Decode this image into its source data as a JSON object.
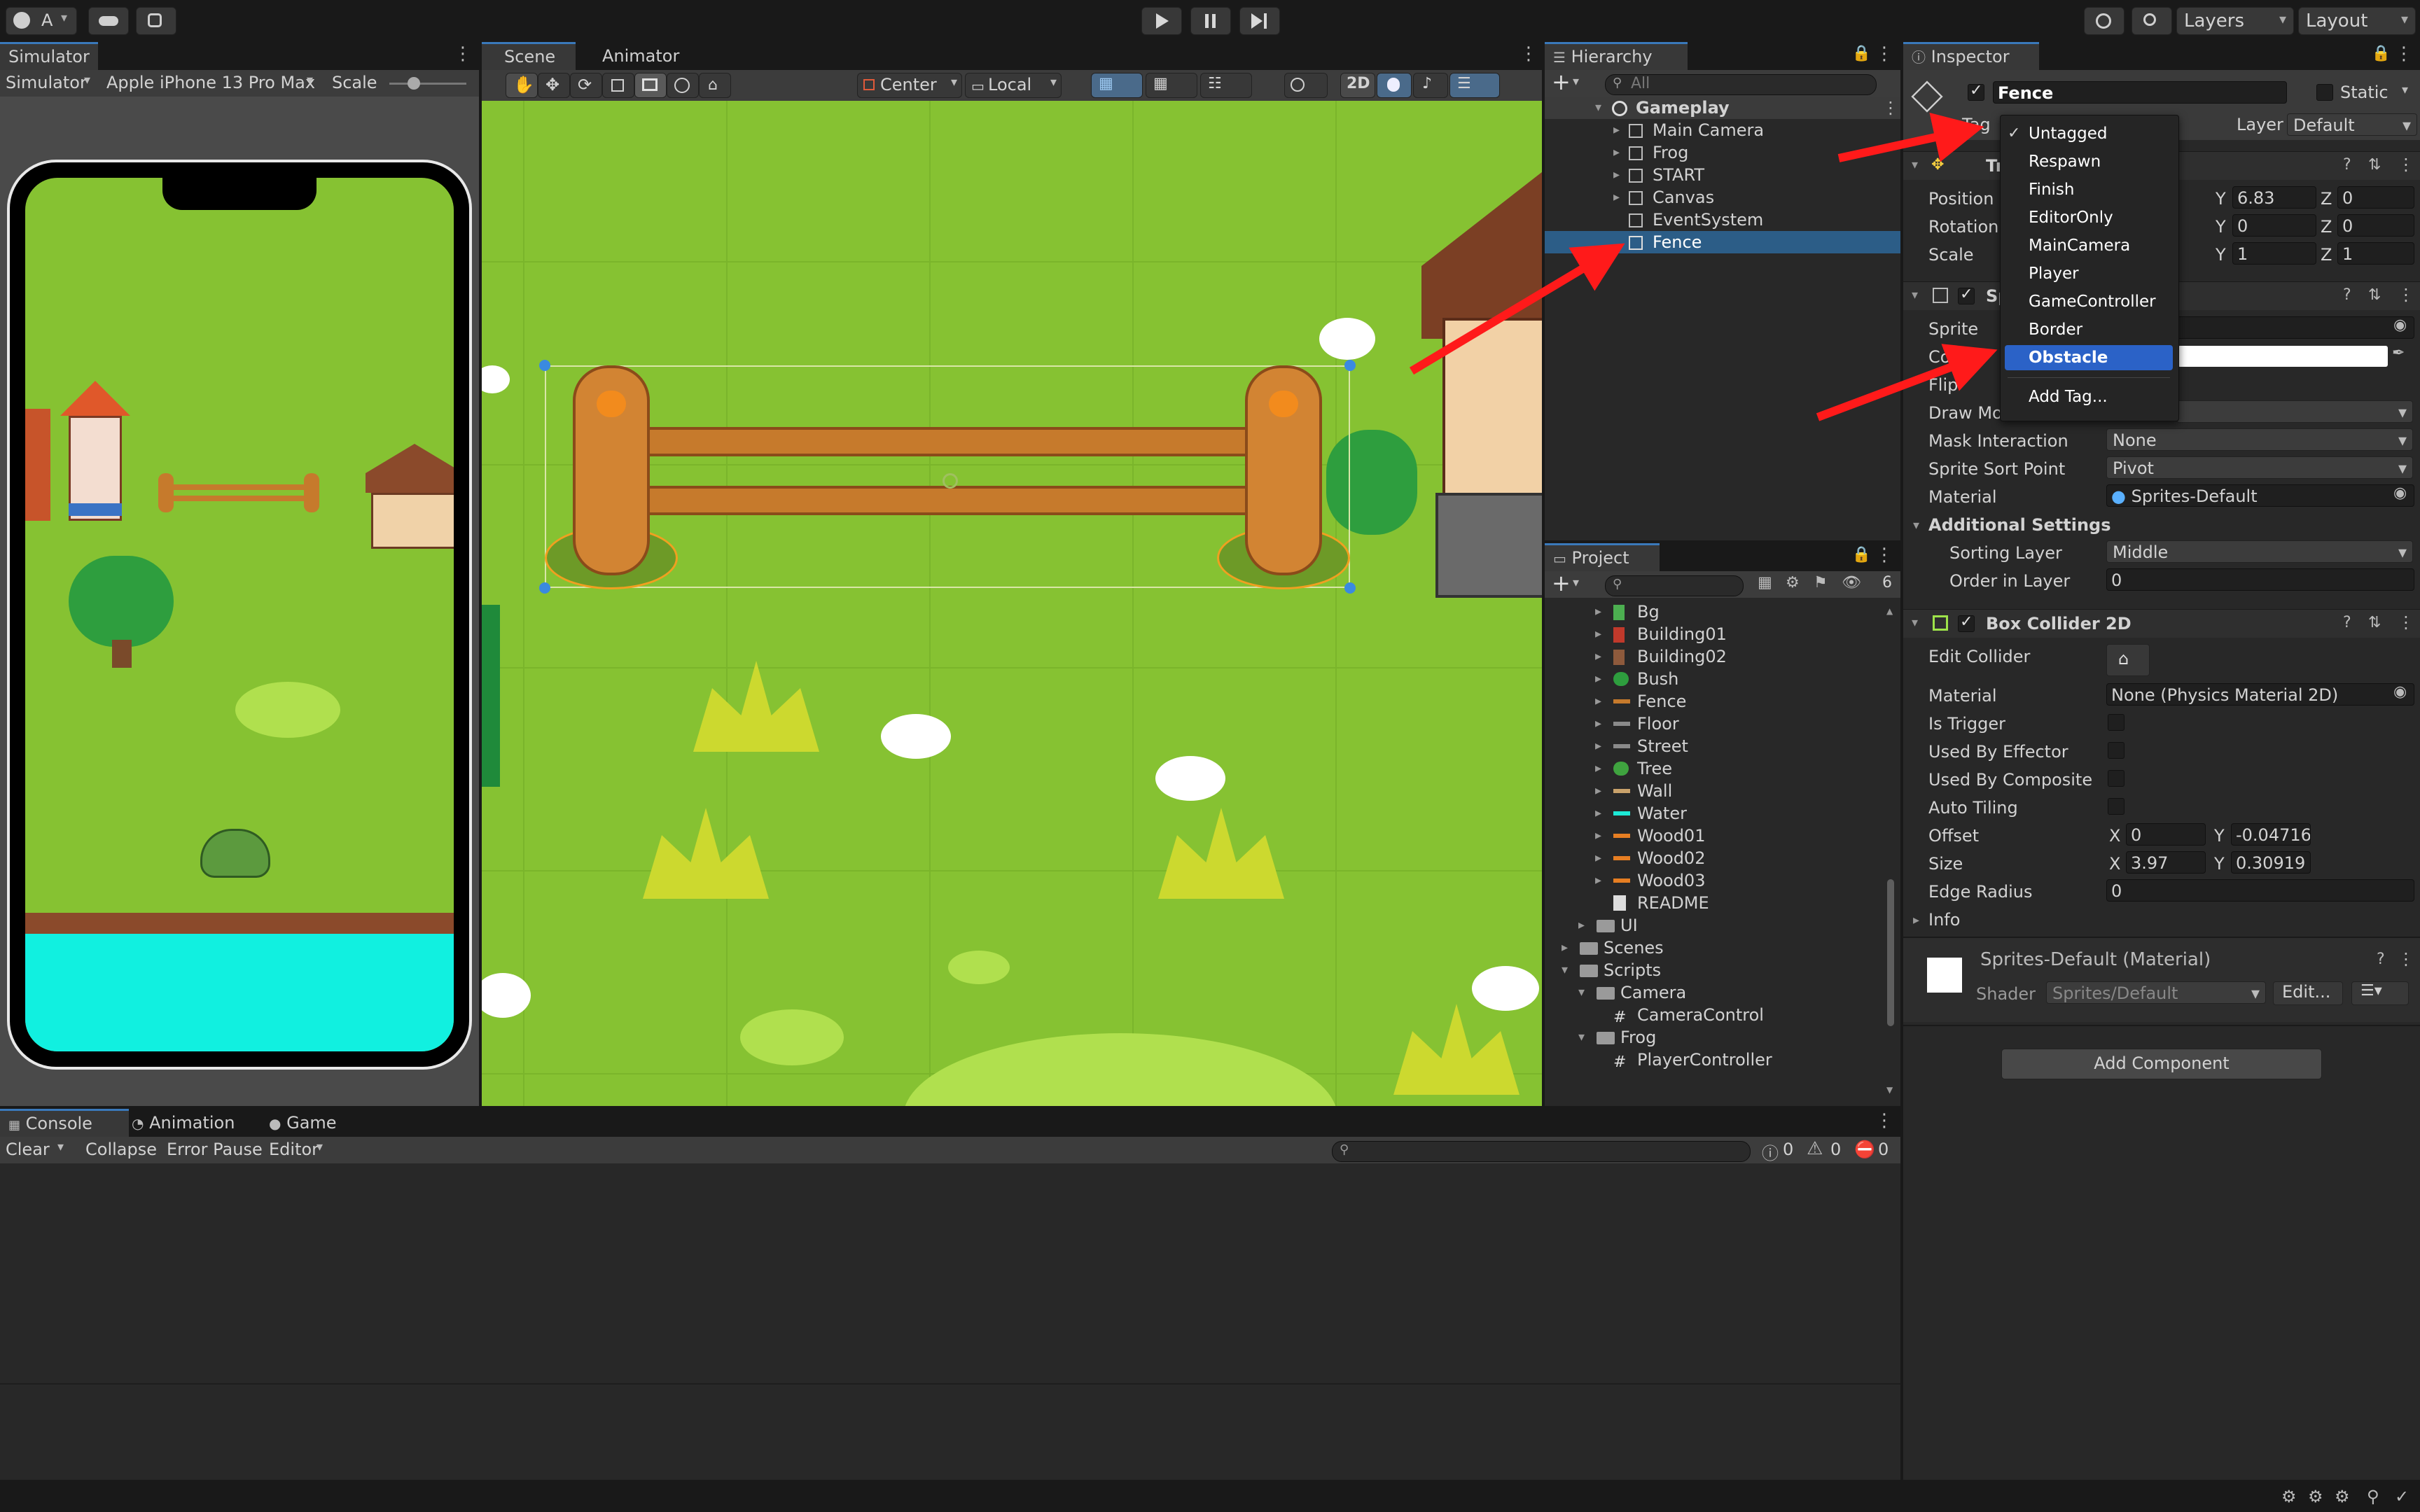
{
  "top_bar": {
    "account_label": "A",
    "layers_label": "Layers",
    "layout_label": "Layout"
  },
  "simulator": {
    "tab_label": "Simulator",
    "mode_label": "Simulator",
    "device_label": "Apple iPhone 13 Pro Max",
    "scale_label": "Scale"
  },
  "scene": {
    "tabs": [
      "Scene",
      "Animator"
    ],
    "pivot_label": "Center",
    "space_label": "Local",
    "mode_2d_label": "2D"
  },
  "hierarchy": {
    "tab_label": "Hierarchy",
    "search_placeholder": "All",
    "scene_name": "Gameplay",
    "items": [
      "Main Camera",
      "Frog",
      "START",
      "Canvas",
      "EventSystem",
      "Fence"
    ],
    "selected": "Fence"
  },
  "project": {
    "tab_label": "Project",
    "hidden_count": "6",
    "assets": [
      "Bg",
      "Building01",
      "Building02",
      "Bush",
      "Fence",
      "Floor",
      "Street",
      "Tree",
      "Wall",
      "Water",
      "Wood01",
      "Wood02",
      "Wood03",
      "README",
      "UI",
      "Scenes",
      "Scripts",
      "Camera",
      "CameraControl",
      "Frog",
      "PlayerController"
    ],
    "asset_colors": [
      "#4caf50",
      "#c0392b",
      "#8e5a3c",
      "#2e9e3e",
      "#c67a2c",
      "#8a8a8a",
      "#8a8a8a",
      "#3fa33f",
      "#c9a26b",
      "#1de9d6",
      "#e67e22",
      "#e67e22",
      "#e67e22"
    ]
  },
  "console": {
    "tabs": [
      "Console",
      "Animation",
      "Game"
    ],
    "clear_label": "Clear",
    "collapse_label": "Collapse",
    "error_pause_label": "Error Pause",
    "editor_label": "Editor",
    "log_count": "0",
    "warn_count": "0",
    "error_count": "0"
  },
  "inspector": {
    "tab_label": "Inspector",
    "object_name": "Fence",
    "static_label": "Static",
    "tag_label": "Tag",
    "layer_label": "Layer",
    "layer_value": "Default",
    "transform": {
      "title": "Tr",
      "position_label": "Position",
      "rotation_label": "Rotation",
      "scale_label": "Scale",
      "position_y": "6.83",
      "position_z": "0",
      "rotation_y": "0",
      "rotation_z": "0",
      "scale_y": "1",
      "scale_z": "1",
      "axis_x": "X",
      "axis_y": "Y",
      "axis_z": "Z"
    },
    "sprite_renderer": {
      "title": "Sp",
      "sprite_label": "Sprite",
      "color_label": "Color",
      "flip_label": "Flip",
      "draw_mode_label": "Draw Mo",
      "mask_label": "Mask Interaction",
      "mask_value": "None",
      "sort_point_label": "Sprite Sort Point",
      "sort_point_value": "Pivot",
      "material_label": "Material",
      "material_value": "Sprites-Default",
      "additional_label": "Additional Settings",
      "sorting_layer_label": "Sorting Layer",
      "sorting_layer_value": "Middle",
      "order_label": "Order in Layer",
      "order_value": "0"
    },
    "box_collider": {
      "title": "Box Collider 2D",
      "edit_label": "Edit Collider",
      "material_label": "Material",
      "material_value": "None (Physics Material 2D)",
      "trigger_label": "Is Trigger",
      "effector_label": "Used By Effector",
      "composite_label": "Used By Composite",
      "tiling_label": "Auto Tiling",
      "offset_label": "Offset",
      "offset_x": "0",
      "offset_y": "-0.04716",
      "size_label": "Size",
      "size_x": "3.97",
      "size_y": "0.30919",
      "edge_label": "Edge Radius",
      "edge_value": "0",
      "info_label": "Info"
    },
    "material": {
      "name": "Sprites-Default (Material)",
      "shader_label": "Shader",
      "shader_value": "Sprites/Default",
      "edit_label": "Edit..."
    },
    "add_component_label": "Add Component"
  },
  "tag_dropdown": {
    "items": [
      "Untagged",
      "Respawn",
      "Finish",
      "EditorOnly",
      "MainCamera",
      "Player",
      "GameController",
      "Border",
      "Obstacle"
    ],
    "checked": "Untagged",
    "highlighted": "Obstacle",
    "add_label": "Add Tag..."
  },
  "colors": {
    "accent_blue": "#2b62c7",
    "selection_blue": "#2c5d87",
    "arrow_red": "#ff1a1a",
    "grass": "#86c232",
    "water": "#11f0e0"
  }
}
